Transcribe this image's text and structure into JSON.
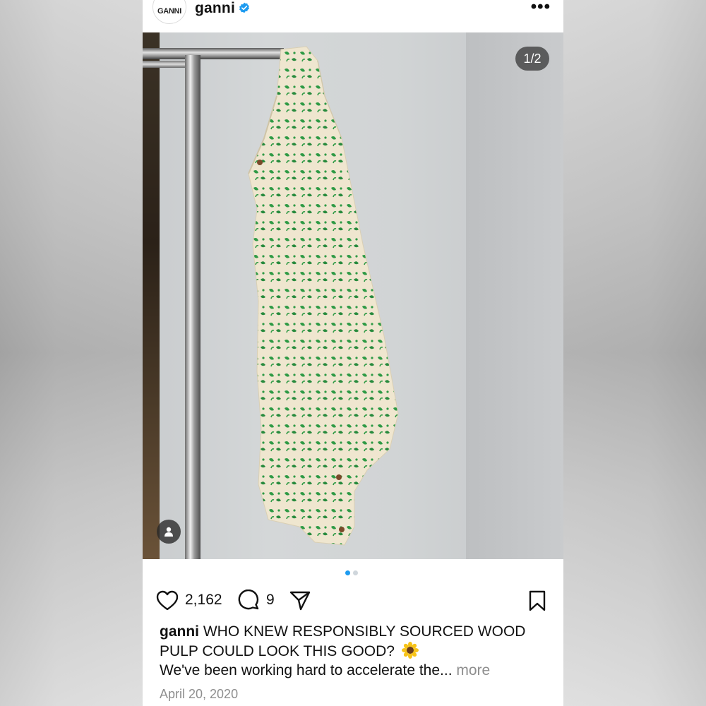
{
  "post": {
    "avatar_text": "GANNI",
    "username": "ganni",
    "verified_icon": "verified-badge-icon",
    "more_icon": "more-options-icon",
    "more_glyph": "•••",
    "page_indicator": "1/2",
    "carousel": {
      "total": 2,
      "active_index": 0
    },
    "likes": "2,162",
    "comments": "9",
    "caption_user": "ganni",
    "caption_text": "WHO KNEW RESPONSIBLY SOURCED WOOD PULP COULD LOOK THIS GOOD?",
    "caption_line2": "We've been working hard to accelerate the...",
    "more_label": "more",
    "date": "April 20, 2020"
  },
  "colors": {
    "accent_blue": "#1d9bf0",
    "print_green": "#2e9a45",
    "fabric": "#efe6cf"
  }
}
